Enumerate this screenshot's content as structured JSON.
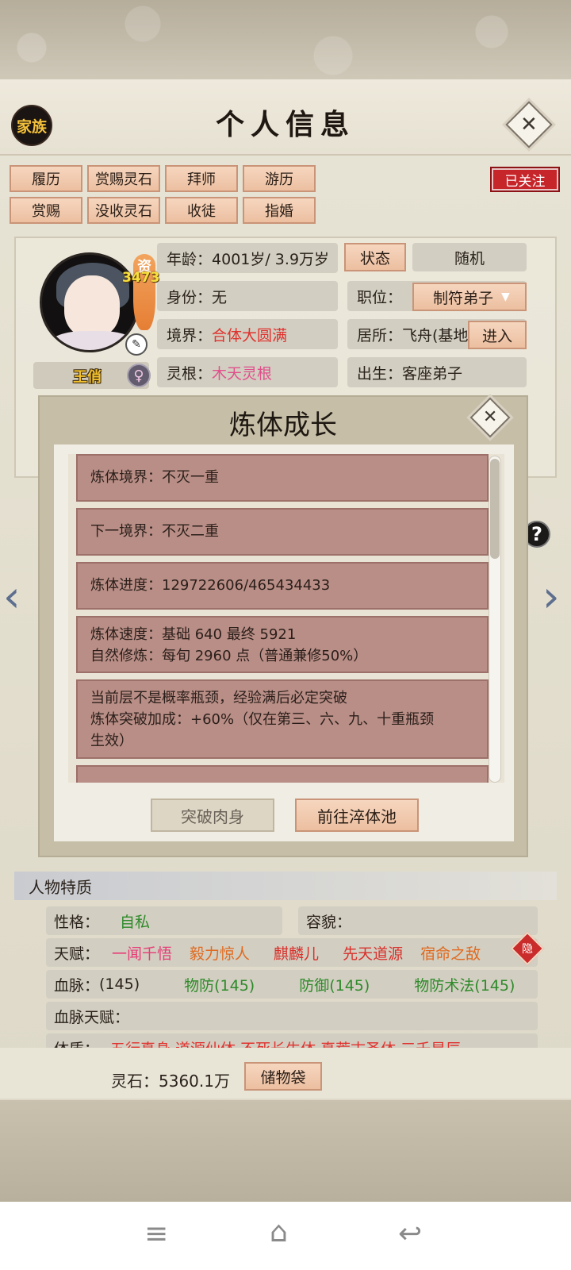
{
  "header": {
    "family_btn": "家族",
    "title": "个人信息"
  },
  "actions": {
    "row1": [
      "履历",
      "赏赐灵石",
      "拜师",
      "游历"
    ],
    "row2": [
      "赏赐",
      "没收灵石",
      "收徒",
      "指婚"
    ],
    "follow": "已关注"
  },
  "character": {
    "zi_label": "资",
    "zi_value": "3473",
    "name": "王俏",
    "gender_symbol": "♀"
  },
  "info": {
    "age_label": "年龄：",
    "age_value": "4001岁/ 3.9万岁",
    "status_btn": "状态",
    "random_btn": "随机",
    "identity_label": "身份：",
    "identity_value": "无",
    "position_label": "职位：",
    "position_value": "制符弟子",
    "realm_label": "境界：",
    "realm_value": "合体大圆满",
    "residence_label": "居所：",
    "residence_value": "飞舟(基地",
    "enter_btn": "进入",
    "root_label": "灵根：",
    "root_value": "木天灵根",
    "birth_label": "出生：",
    "birth_value": "客座弟子"
  },
  "modal": {
    "title": "炼体成长",
    "entries": [
      "炼体境界：不灭一重",
      "下一境界：不灭二重",
      "炼体进度：129722606/465434433",
      "炼体速度：基础 640 最终 5921\n自然修炼：每旬 2960 点（普通兼修50%）",
      "当前层不是概率瓶颈，经验满后必定突破\n炼体突破加成：+60%（仅在第三、六、九、十重瓶颈\n生效）"
    ],
    "btn_break": "突破肉身",
    "btn_pool": "前往淬体池"
  },
  "traits": {
    "header": "人物特质",
    "personality_label": "性格：",
    "personality_value": "自私",
    "looks_label": "容貌：",
    "talent_label": "天赋：",
    "talents": [
      {
        "text": "一闻千悟",
        "color": "#e63d77"
      },
      {
        "text": "毅力惊人",
        "color": "#e06a20"
      },
      {
        "text": "麒麟儿",
        "color": "#d9302b"
      },
      {
        "text": "先天道源",
        "color": "#d9302b"
      },
      {
        "text": "宿命之敌",
        "color": "#e06a20"
      }
    ],
    "hidden_badge": "隐",
    "bloodline_label": "血脉：",
    "bloodlines": [
      {
        "text": "(145)",
        "color": "#2a221c"
      },
      {
        "text": "物防(145)",
        "color": "#2f8a2b"
      },
      {
        "text": "防御(145)",
        "color": "#2f8a2b"
      },
      {
        "text": "物防术法(145)",
        "color": "#2f8a2b"
      }
    ],
    "bloodline_talent_label": "血脉天赋：",
    "physique_label": "体质：",
    "physique_values": "五行真身  道源仙体  不死长生体  真荒古圣体  三千星辰"
  },
  "footer": {
    "stone_label": "灵石：5360.1万",
    "bag_btn": "储物袋"
  },
  "nav": {
    "menu_icon": "≡",
    "home_icon": "⌂",
    "back_icon": "↩"
  }
}
